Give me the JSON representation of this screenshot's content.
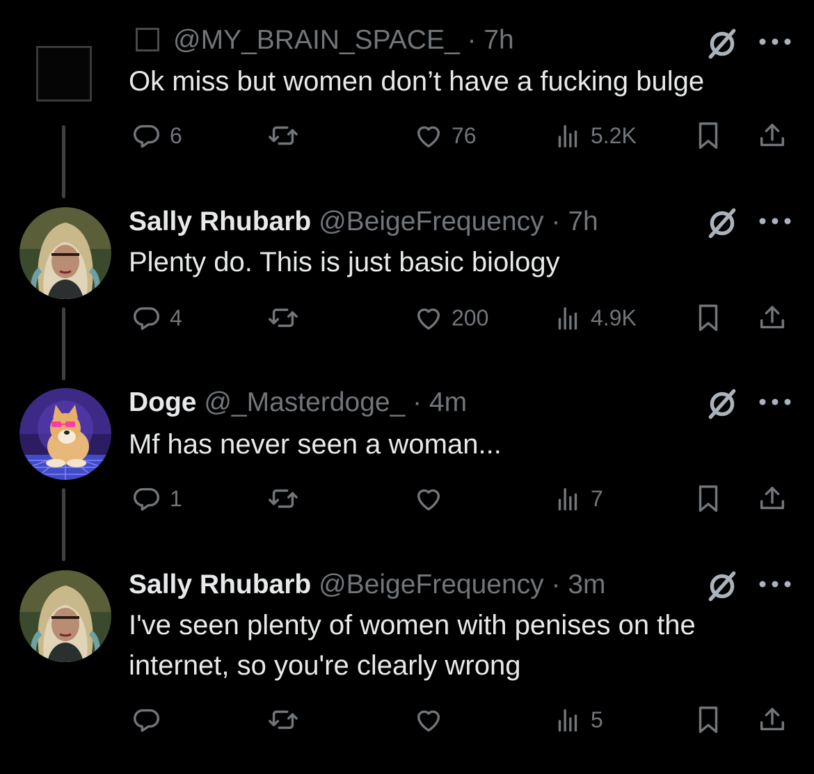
{
  "tweets": [
    {
      "name": "",
      "handle": "@MY_BRAIN_SPACE_",
      "time": "· 7h",
      "text": "Ok miss but women don’t have a fucking bulge",
      "replies": "6",
      "retweets": "",
      "likes": "76",
      "views": "5.2K",
      "avatar": "blank-placeholder"
    },
    {
      "name": "Sally Rhubarb",
      "handle": "@BeigeFrequency",
      "time": "· 7h",
      "text": "Plenty do. This is just basic biology",
      "replies": "4",
      "retweets": "",
      "likes": "200",
      "views": "4.9K",
      "avatar": "woman-portrait"
    },
    {
      "name": "Doge",
      "handle": "@_Masterdoge_",
      "time": "· 4m",
      "text": "Mf has never seen a woman...",
      "replies": "1",
      "retweets": "",
      "likes": "",
      "views": "7",
      "avatar": "doge-synthwave"
    },
    {
      "name": "Sally Rhubarb",
      "handle": "@BeigeFrequency",
      "time": "· 3m",
      "text": "I've seen plenty of women with penises on the internet, so you're clearly wrong",
      "replies": "",
      "retweets": "",
      "likes": "",
      "views": "5",
      "avatar": "woman-portrait"
    }
  ],
  "icons": [
    "reply-icon",
    "retweet-icon",
    "like-icon",
    "views-icon",
    "bookmark-icon",
    "share-icon",
    "grok-icon",
    "more-icon"
  ],
  "colors": {
    "background": "#000000",
    "text": "#e7e9ea",
    "secondary": "#71767b",
    "thread_line": "#3e4144"
  }
}
